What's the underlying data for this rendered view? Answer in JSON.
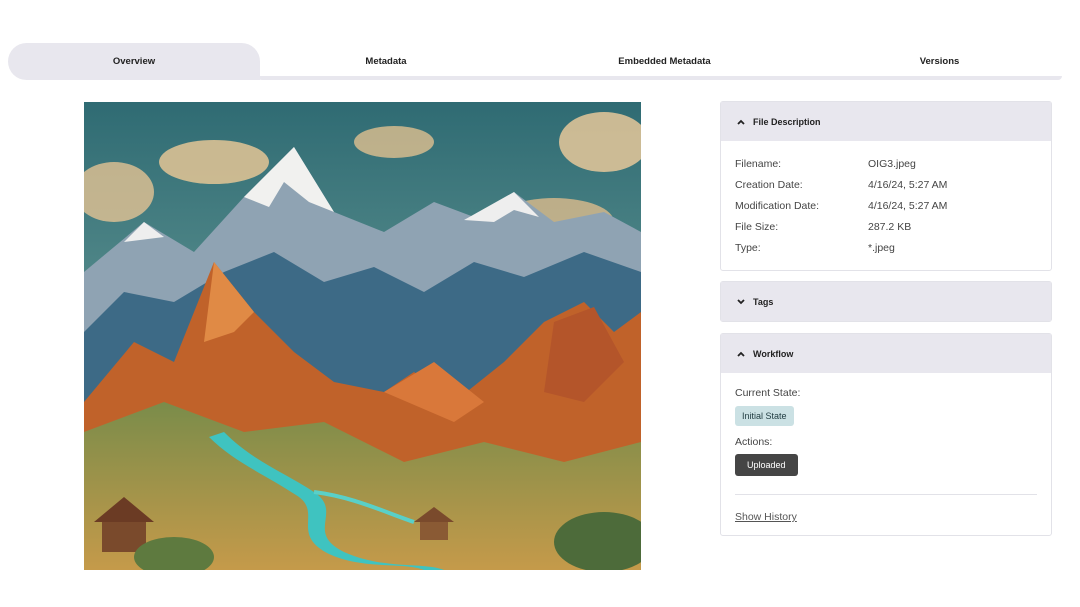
{
  "tabs": [
    {
      "label": "Overview",
      "active": true
    },
    {
      "label": "Metadata",
      "active": false
    },
    {
      "label": "Embedded Metadata",
      "active": false
    },
    {
      "label": "Versions",
      "active": false
    }
  ],
  "preview": {
    "icon": "fantasy-mountain-landscape-image",
    "palette": {
      "sky": "#3f7f86",
      "cloud": "#e6c89a",
      "rock": "#c0622a",
      "snow": "#eef0f0",
      "river": "#3fc3c0",
      "valley": "#b8a04e"
    }
  },
  "file_description": {
    "title": "File Description",
    "expanded": true,
    "rows": [
      {
        "key": "Filename:",
        "value": "OIG3.jpeg"
      },
      {
        "key": "Creation Date:",
        "value": "4/16/24, 5:27 AM"
      },
      {
        "key": "Modification Date:",
        "value": "4/16/24, 5:27 AM"
      },
      {
        "key": "File Size:",
        "value": "287.2 KB"
      },
      {
        "key": "Type:",
        "value": "*.jpeg"
      }
    ]
  },
  "tags": {
    "title": "Tags",
    "expanded": false
  },
  "workflow": {
    "title": "Workflow",
    "expanded": true,
    "current_state_label": "Current State:",
    "current_state": "Initial State",
    "actions_label": "Actions:",
    "action_button": "Uploaded",
    "history_link": "Show History"
  },
  "colors": {
    "tab_bg": "#e8e7ee",
    "badge_bg": "#cbe1e4",
    "button_bg": "#454545"
  }
}
